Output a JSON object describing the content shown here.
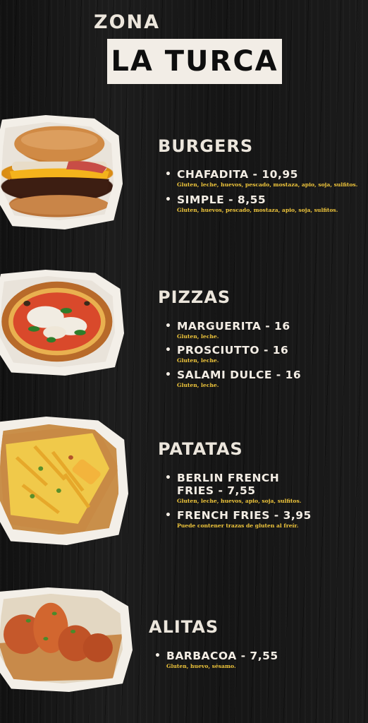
{
  "header": {
    "zona": "ZONA",
    "title": "LA TURCA"
  },
  "sections": [
    {
      "title": "BURGERS",
      "image_icon": "burger-photo",
      "items": [
        {
          "name": "CHAFADITA - 10,95",
          "allergens": "Gluten, leche, huevos, pescado, mostaza, apio, soja, sulfitos."
        },
        {
          "name": "SIMPLE - 8,55",
          "allergens": "Gluten, huevos, pescado, mostaza, apio, soja, sulfitos."
        }
      ]
    },
    {
      "title": "PIZZAS",
      "image_icon": "pizza-photo",
      "items": [
        {
          "name": "MARGUERITA - 16",
          "allergens": "Gluten, leche."
        },
        {
          "name": "PROSCIUTTO - 16",
          "allergens": "Gluten, leche."
        },
        {
          "name": "SALAMI DULCE - 16",
          "allergens": "Gluten, leche."
        }
      ]
    },
    {
      "title": "PATATAS",
      "image_icon": "fries-photo",
      "items": [
        {
          "name_line1": "BERLIN FRENCH",
          "name_line2": "FRIES - 7,55",
          "allergens": "Gluten, leche, huevos, apio, soja, sulfitos."
        },
        {
          "name": "FRENCH FRIES - 3,95",
          "allergens": "Puede contener trazas de gluten al freír."
        }
      ]
    },
    {
      "title": "ALITAS",
      "image_icon": "wings-photo",
      "items": [
        {
          "name": "BARBACOA - 7,55",
          "allergens": "Gluten, huevo, sésamo."
        }
      ]
    }
  ],
  "colors": {
    "background": "#141414",
    "text": "#ece6dc",
    "allergens": "#f0c63b",
    "title_box": "#f2ede6"
  }
}
